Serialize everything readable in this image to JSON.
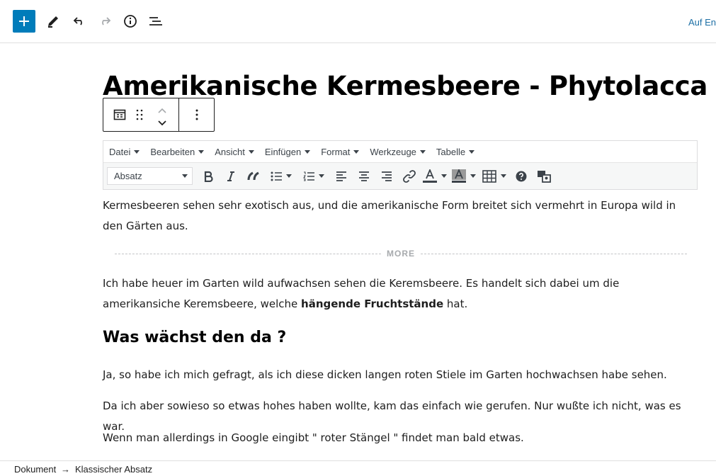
{
  "toolbar": {
    "add_label": "+",
    "icons": [
      "plus-icon",
      "pencil-icon",
      "undo-icon",
      "redo-icon",
      "info-icon",
      "list-view-icon"
    ],
    "right_link": "Auf En",
    "accent": "#007cba"
  },
  "post": {
    "title": "Amerikanische Kermesbeere - Phytolacca"
  },
  "block_toolbar": {
    "icons": [
      "classic-block-icon",
      "drag-handle-icon",
      "move-up-icon",
      "move-down-icon",
      "more-options-icon"
    ]
  },
  "classic_editor": {
    "menus": [
      "Datei",
      "Bearbeiten",
      "Ansicht",
      "Einfügen",
      "Format",
      "Werkzeuge",
      "Tabelle"
    ],
    "format_value": "Absatz",
    "tool_icons": [
      "bold-icon",
      "italic-icon",
      "blockquote-icon",
      "bullet-list-icon",
      "numbered-list-icon",
      "align-left-icon",
      "align-center-icon",
      "align-right-icon",
      "link-icon",
      "text-color-icon",
      "background-color-icon",
      "table-icon",
      "help-icon",
      "media-icon"
    ]
  },
  "content": {
    "intro": "Kermesbeeren sehen sehr exotisch aus, und die amerikanische Form breitet sich vermehrt in Europa wild in den Gärten aus.",
    "more_label": "MORE",
    "p2_before": "Ich habe heuer im Garten wild aufwachsen sehen die Keremsbeere. Es handelt sich dabei um die amerikansiche Keremsbeere, welche ",
    "p2_bold": "hängende Fruchtstände",
    "p2_after": " hat.",
    "heading": "Was wächst den da ?",
    "p3": "Ja, so habe ich mich gefragt, als ich diese dicken langen roten Stiele im Garten hochwachsen habe sehen.",
    "p4": "Da ich aber sowieso so etwas hohes haben wollte, kam das einfach wie gerufen. Nur wußte ich nicht, was es war.",
    "p5": "Wenn man allerdings in Google eingibt \" roter Stängel \" findet man bald etwas."
  },
  "breadcrumb": {
    "root": "Dokument",
    "separator": "→",
    "current": "Klassischer Absatz"
  }
}
